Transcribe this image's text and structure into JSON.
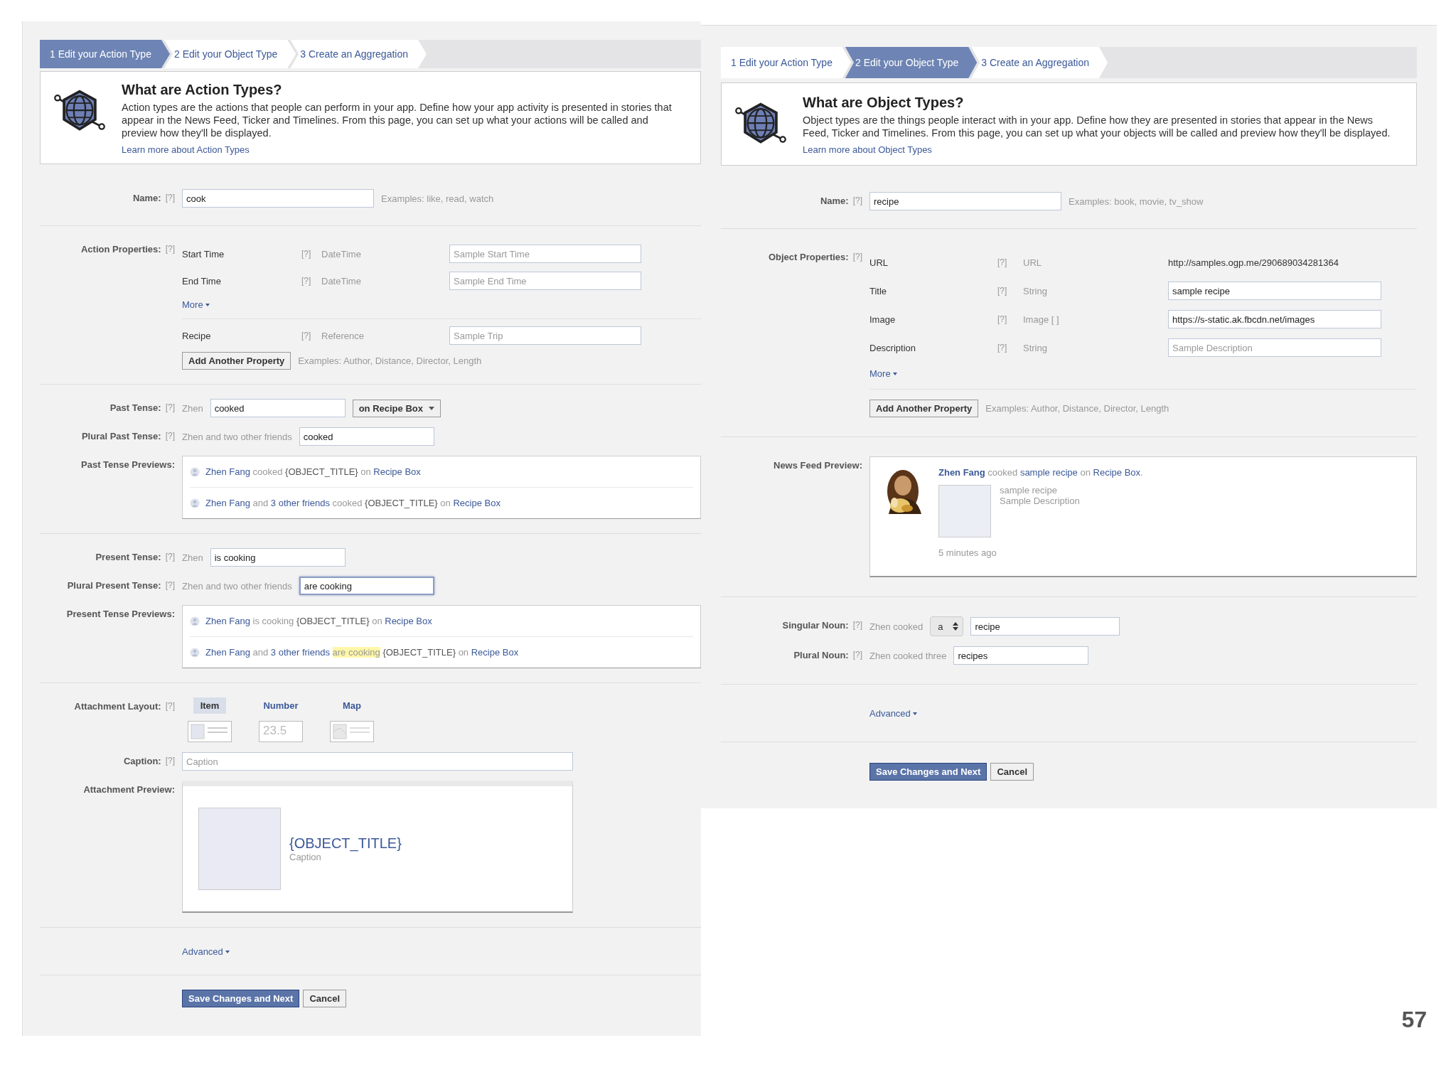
{
  "panels": [
    {
      "steps": [
        {
          "label": "1 Edit your Action Type",
          "selected": true
        },
        {
          "label": "2 Edit your Object Type",
          "selected": false
        },
        {
          "label": "3 Create an Aggregation",
          "selected": false
        }
      ],
      "intro": {
        "title": "What are Action Types?",
        "text": "Action types are the actions that people can perform in your app. Define how your app activity is presented in stories that appear in the News Feed, Ticker and Timelines. From this page, you can set up what your actions will be called and preview how they'll be displayed.",
        "link": "Learn more about Action Types"
      },
      "sections": [
        {
          "kind": "name",
          "label": "Name:",
          "help": "[?]",
          "value": "cook",
          "hint": "Examples: like, read, watch"
        },
        {
          "kind": "properties",
          "label": "Action Properties:",
          "help": "[?]",
          "rows": [
            {
              "name": "Start Time",
              "help": "[?]",
              "type": "DateTime",
              "kind": "input",
              "placeholder": "Sample Start Time"
            },
            {
              "name": "End Time",
              "help": "[?]",
              "type": "DateTime",
              "kind": "input",
              "placeholder": "Sample End Time"
            }
          ],
          "more": "More",
          "extra_rows": [
            {
              "name": "Recipe",
              "help": "[?]",
              "type": "Reference",
              "kind": "input",
              "placeholder": "Sample Trip"
            }
          ],
          "add_button": "Add Another Property",
          "add_hint": "Examples: Author, Distance, Director, Length"
        },
        {
          "kind": "group",
          "rows": [
            {
              "kind": "input",
              "label": "Past Tense:",
              "help": "[?]",
              "prefix": "Zhen",
              "value": "cooked",
              "focused": false,
              "dropdown": "on Recipe Box"
            },
            {
              "kind": "input",
              "label": "Plural Past Tense:",
              "help": "[?]",
              "prefix": "Zhen and two other friends",
              "value": "cooked",
              "focused": false
            },
            {
              "kind": "previews",
              "label": "Past Tense Previews:",
              "lines": [
                [
                  {
                    "text": "Zhen Fang",
                    "kind": "link"
                  },
                  {
                    "text": "cooked",
                    "kind": "muted"
                  },
                  {
                    "text": "{OBJECT_TITLE}",
                    "kind": "plain"
                  },
                  {
                    "text": "on",
                    "kind": "muted"
                  },
                  {
                    "text": "Recipe Box",
                    "kind": "link"
                  }
                ],
                [
                  {
                    "text": "Zhen Fang",
                    "kind": "link"
                  },
                  {
                    "text": "and",
                    "kind": "muted"
                  },
                  {
                    "text": "3 other friends",
                    "kind": "link"
                  },
                  {
                    "text": "cooked",
                    "kind": "muted"
                  },
                  {
                    "text": "{OBJECT_TITLE}",
                    "kind": "plain"
                  },
                  {
                    "text": "on",
                    "kind": "muted"
                  },
                  {
                    "text": "Recipe Box",
                    "kind": "link"
                  }
                ]
              ]
            }
          ]
        },
        {
          "kind": "group",
          "rows": [
            {
              "kind": "input",
              "label": "Present Tense:",
              "help": "[?]",
              "prefix": "Zhen",
              "value": "is cooking",
              "focused": false
            },
            {
              "kind": "input",
              "label": "Plural Present Tense:",
              "help": "[?]",
              "prefix": "Zhen and two other friends",
              "value": "are cooking",
              "focused": true
            },
            {
              "kind": "previews",
              "label": "Present Tense Previews:",
              "lines": [
                [
                  {
                    "text": "Zhen Fang",
                    "kind": "link"
                  },
                  {
                    "text": "is cooking",
                    "kind": "muted"
                  },
                  {
                    "text": "{OBJECT_TITLE}",
                    "kind": "plain"
                  },
                  {
                    "text": "on",
                    "kind": "muted"
                  },
                  {
                    "text": "Recipe Box",
                    "kind": "link"
                  }
                ],
                [
                  {
                    "text": "Zhen Fang",
                    "kind": "link"
                  },
                  {
                    "text": "and",
                    "kind": "muted"
                  },
                  {
                    "text": "3 other friends",
                    "kind": "link"
                  },
                  {
                    "text": "are cooking",
                    "kind": "highlight"
                  },
                  {
                    "text": "{OBJECT_TITLE}",
                    "kind": "plain"
                  },
                  {
                    "text": "on",
                    "kind": "muted"
                  },
                  {
                    "text": "Recipe Box",
                    "kind": "link"
                  }
                ]
              ]
            }
          ]
        },
        {
          "kind": "group",
          "rows": [
            {
              "kind": "layout",
              "label": "Attachment Layout:",
              "help": "[?]",
              "options": [
                {
                  "label": "Item",
                  "selected": true,
                  "kind": "item"
                },
                {
                  "label": "Number",
                  "selected": false,
                  "kind": "number",
                  "sample": "23.5"
                },
                {
                  "label": "Map",
                  "selected": false,
                  "kind": "map"
                }
              ]
            },
            {
              "kind": "caption",
              "label": "Caption:",
              "help": "[?]",
              "placeholder": "Caption"
            },
            {
              "kind": "attachment",
              "label": "Attachment Preview:",
              "title": "{OBJECT_TITLE}",
              "caption": "Caption"
            }
          ]
        },
        {
          "kind": "advanced",
          "link": "Advanced"
        },
        {
          "kind": "buttons",
          "save": "Save Changes and Next",
          "cancel": "Cancel"
        }
      ]
    },
    {
      "steps": [
        {
          "label": "1 Edit your Action Type",
          "selected": false
        },
        {
          "label": "2 Edit your Object Type",
          "selected": true
        },
        {
          "label": "3 Create an Aggregation",
          "selected": false
        }
      ],
      "intro": {
        "title": "What are Object Types?",
        "text": "Object types are the things people interact with in your app. Define how they are presented in stories that appear in the News Feed, Ticker and Timelines. From this page, you can set up what your objects will be called and preview how they'll be displayed.",
        "link": "Learn more about Object Types"
      },
      "sections": [
        {
          "kind": "name",
          "label": "Name:",
          "help": "[?]",
          "value": "recipe",
          "hint": "Examples: book, movie, tv_show"
        },
        {
          "kind": "properties",
          "label": "Object Properties:",
          "help": "[?]",
          "rows": [
            {
              "name": "URL",
              "help": "[?]",
              "type": "URL",
              "kind": "text",
              "value": "http://samples.ogp.me/290689034281364"
            },
            {
              "name": "Title",
              "help": "[?]",
              "type": "String",
              "kind": "input",
              "value": "sample recipe"
            },
            {
              "name": "Image",
              "help": "[?]",
              "type": "Image [ ]",
              "kind": "input",
              "value": "https://s-static.ak.fbcdn.net/images"
            },
            {
              "name": "Description",
              "help": "[?]",
              "type": "String",
              "kind": "input",
              "placeholder": "Sample Description"
            }
          ],
          "more": "More",
          "add_button": "Add Another Property",
          "add_hint": "Examples: Author, Distance, Director, Length"
        },
        {
          "kind": "group",
          "rows": [
            {
              "kind": "newsfeed",
              "label": "News Feed Preview:",
              "story": [
                {
                  "text": "Zhen Fang",
                  "kind": "strong"
                },
                {
                  "text": "cooked",
                  "kind": "muted"
                },
                {
                  "text": "sample recipe",
                  "kind": "link"
                },
                {
                  "text": "on",
                  "kind": "muted"
                },
                {
                  "text": "Recipe Box",
                  "kind": "link"
                },
                {
                  "text": ".",
                  "kind": "muted"
                }
              ],
              "title": "sample recipe",
              "description": "Sample Description",
              "time": "5 minutes ago"
            }
          ]
        },
        {
          "kind": "group",
          "rows": [
            {
              "kind": "noun",
              "label": "Singular Noun:",
              "help": "[?]",
              "prefix": "Zhen cooked",
              "article": "a",
              "value": "recipe"
            },
            {
              "kind": "input",
              "label": "Plural Noun:",
              "help": "[?]",
              "prefix": "Zhen cooked three",
              "value": "recipes",
              "focused": false
            }
          ]
        },
        {
          "kind": "advanced",
          "link": "Advanced"
        },
        {
          "kind": "buttons",
          "save": "Save Changes and Next",
          "cancel": "Cancel"
        }
      ]
    }
  ],
  "page_number": "57"
}
